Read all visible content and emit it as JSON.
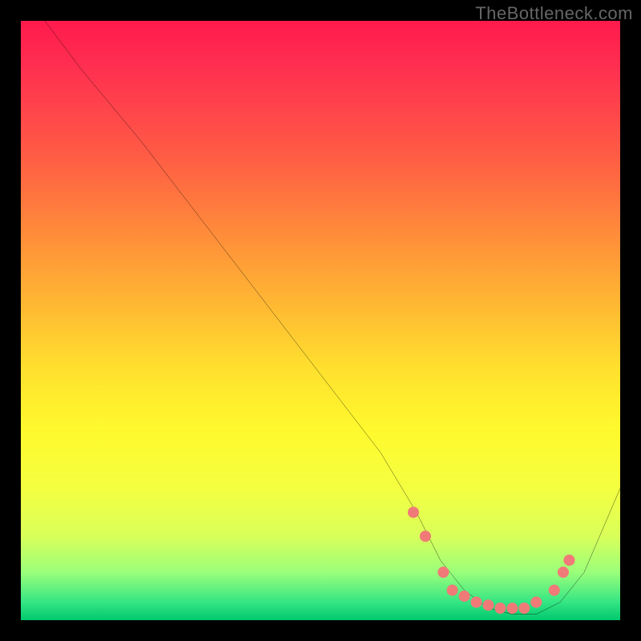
{
  "watermark": "TheBottleneck.com",
  "chart_data": {
    "type": "line",
    "title": "",
    "xlabel": "",
    "ylabel": "",
    "xlim": [
      0,
      100
    ],
    "ylim": [
      0,
      100
    ],
    "grid": false,
    "legend": false,
    "series": [
      {
        "name": "bottleneck-curve",
        "x": [
          4,
          10,
          20,
          30,
          40,
          50,
          60,
          66,
          70,
          74,
          78,
          82,
          86,
          90,
          94,
          100
        ],
        "y": [
          100,
          92,
          80,
          67,
          54,
          41,
          28,
          18,
          10,
          5,
          2,
          1,
          1,
          3,
          8,
          22
        ],
        "stroke": "#000000",
        "stroke_width": 2
      }
    ],
    "marker_points": {
      "name": "highlight-dots",
      "color": "#f07a78",
      "radius": 7,
      "points": [
        {
          "x": 65.5,
          "y": 18
        },
        {
          "x": 67.5,
          "y": 14
        },
        {
          "x": 70.5,
          "y": 8
        },
        {
          "x": 72.0,
          "y": 5
        },
        {
          "x": 74.0,
          "y": 4
        },
        {
          "x": 76.0,
          "y": 3
        },
        {
          "x": 78.0,
          "y": 2.5
        },
        {
          "x": 80.0,
          "y": 2
        },
        {
          "x": 82.0,
          "y": 2
        },
        {
          "x": 84.0,
          "y": 2
        },
        {
          "x": 86.0,
          "y": 3
        },
        {
          "x": 89.0,
          "y": 5
        },
        {
          "x": 90.5,
          "y": 8
        },
        {
          "x": 91.5,
          "y": 10
        }
      ]
    }
  }
}
